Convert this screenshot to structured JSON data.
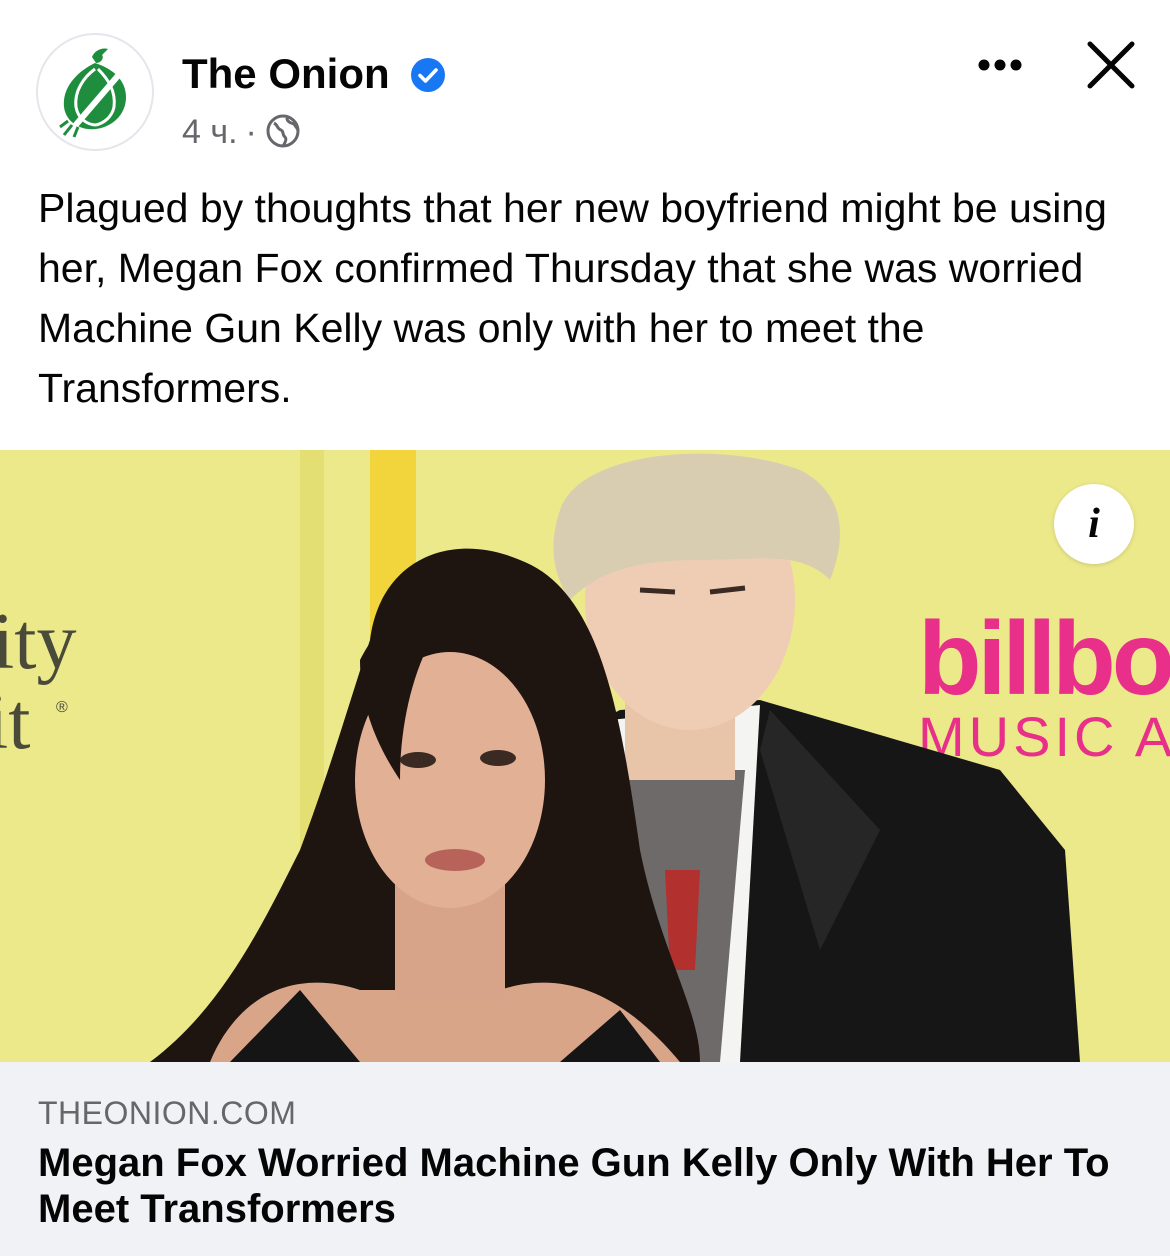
{
  "post": {
    "page_name": "The Onion",
    "time": "4 ч.",
    "separator": "·",
    "text": "Plagued by thoughts that her new boyfriend might be using her, Megan Fox confirmed Thursday that she was worried Machine Gun Kelly was only with her to meet the Transformers."
  },
  "icons": {
    "avatar": "onion-logo",
    "verified": "verified-badge-icon",
    "privacy": "globe-icon",
    "more": "more-options-icon",
    "close": "close-icon",
    "info": "info-icon"
  },
  "photo": {
    "backdrop_text_left_1": "ity",
    "backdrop_text_left_2": "it",
    "backdrop_mark": "®",
    "backdrop_logo": "billbo",
    "backdrop_subtitle": "MUSIC A",
    "info_label": "i"
  },
  "link": {
    "domain": "THEONION.COM",
    "headline": "Megan Fox Worried Machine Gun Kelly Only With Her To Meet Transformers"
  },
  "colors": {
    "onion_green": "#1e8e3e",
    "verified_blue": "#1877f2",
    "secondary_text": "#65676b",
    "card_bg": "#f0f2f5",
    "backdrop_yellow": "#ece98a",
    "billboard_pink": "#e8308a"
  }
}
